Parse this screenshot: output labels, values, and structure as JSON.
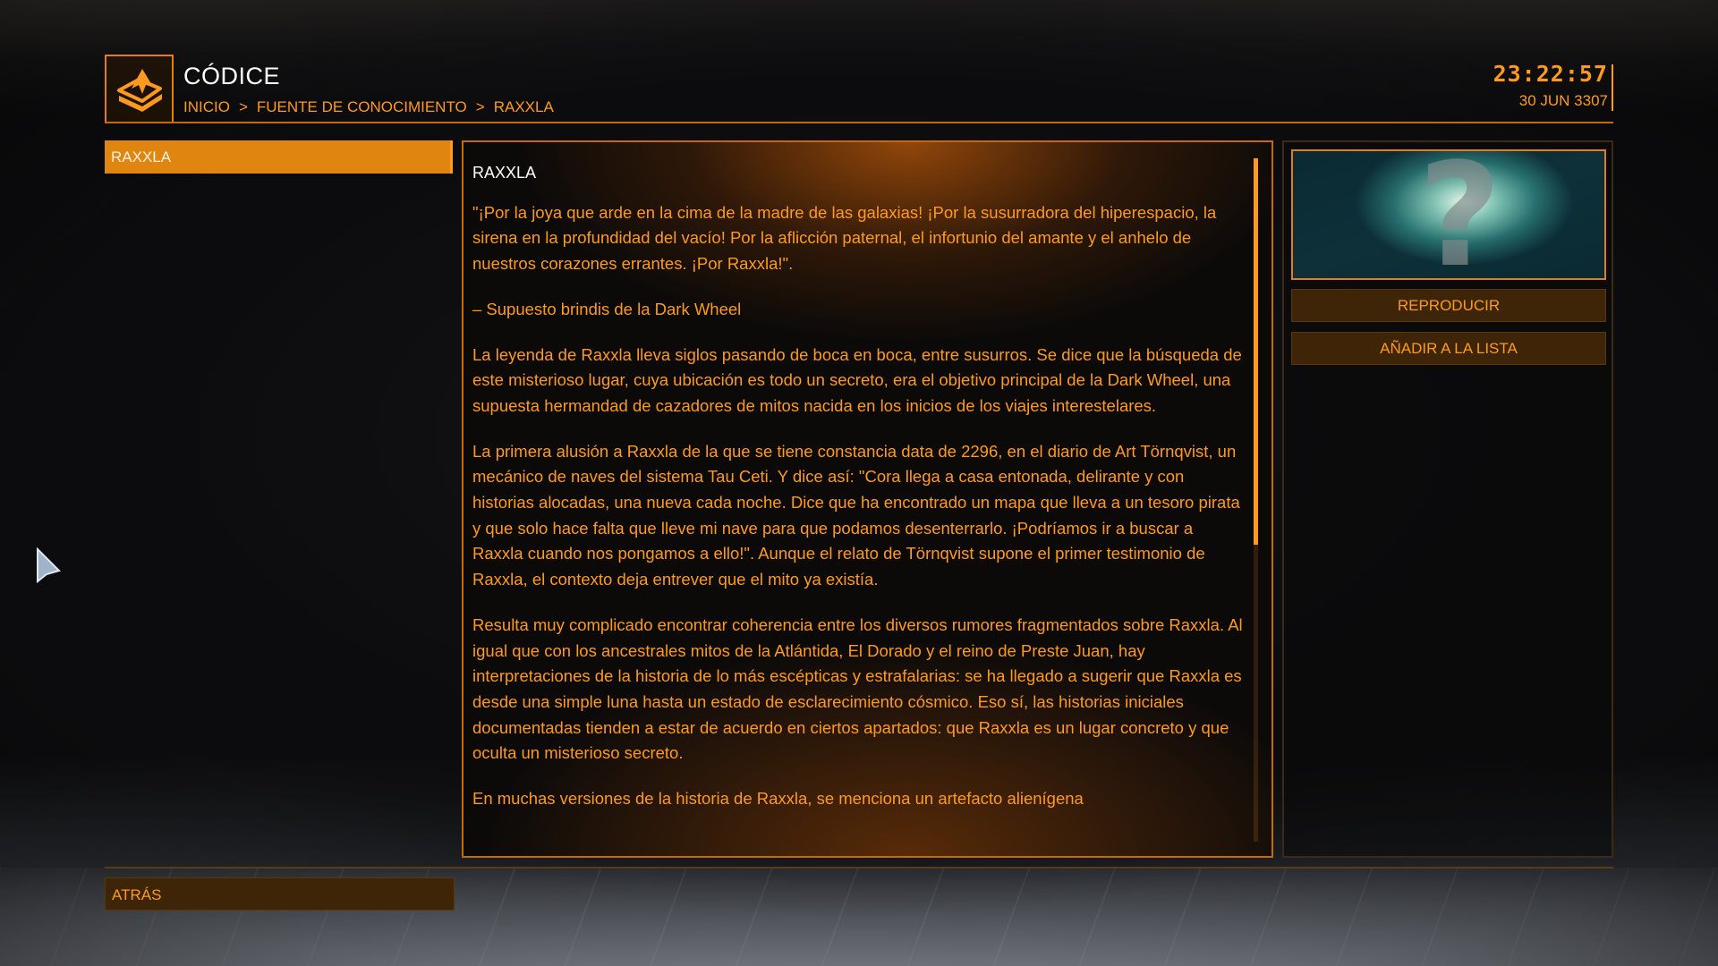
{
  "header": {
    "title": "CÓDICE",
    "logo_icon": "codex-book-icon",
    "breadcrumb": [
      "INICIO",
      ">",
      "FUENTE DE CONOCIMIENTO",
      ">",
      "RAXXLA"
    ],
    "time": "23:22:57",
    "date": "30 JUN 3307"
  },
  "sidebar": {
    "items": [
      {
        "label": "RAXXLA",
        "selected": true
      }
    ]
  },
  "article": {
    "title": "RAXXLA",
    "paragraphs": [
      "\"¡Por la joya que arde en la cima de la madre de las galaxias! ¡Por la susurradora del hiperespacio, la sirena en la profundidad del vacío! Por la aflicción paternal, el infortunio del amante y el anhelo de nuestros corazones errantes. ¡Por Raxxla!\".",
      "– Supuesto brindis de la Dark Wheel",
      "La leyenda de Raxxla lleva siglos pasando de boca en boca, entre susurros. Se dice que la búsqueda de este misterioso lugar, cuya ubicación es todo un secreto, era el objetivo principal de la Dark Wheel, una supuesta hermandad de cazadores de mitos nacida en los inicios de los viajes interestelares.",
      "La primera alusión a Raxxla de la que se tiene constancia data de 2296, en el diario de Art Törnqvist, un mecánico de naves del sistema Tau Ceti. Y dice así: \"Cora llega a casa entonada, delirante y con historias alocadas, una nueva cada noche. Dice que ha encontrado un mapa que lleva a un tesoro pirata y que solo hace falta que lleve mi nave para que podamos desenterrarlo. ¡Podríamos ir a buscar a Raxxla cuando nos pongamos a ello!\". Aunque el relato de Törnqvist supone el primer testimonio de Raxxla, el contexto deja entrever que el mito ya existía.",
      "Resulta muy complicado encontrar coherencia entre los diversos rumores fragmentados sobre Raxxla. Al igual que con los ancestrales mitos de la Atlántida, El Dorado y el reino de Preste Juan, hay interpretaciones de la historia de lo más escépticas y estrafalarias: se ha llegado a sugerir que Raxxla es desde una simple luna hasta un estado de esclarecimiento cósmico. Eso sí, las historias iniciales documentadas tienden a estar de acuerdo en ciertos apartados: que Raxxla es un lugar concreto y que oculta un misterioso secreto.",
      "En muchas versiones de la historia de Raxxla, se menciona un artefacto alienígena"
    ],
    "scroll_position_fraction": 0.0,
    "scroll_visible_fraction": 0.57
  },
  "side_panel": {
    "image_icon": "unknown-question-mark-image",
    "play_label": "REPRODUCIR",
    "add_label": "AÑADIR A LA LISTA"
  },
  "footer": {
    "back_label": "ATRÁS"
  },
  "colors": {
    "accent": "#ff9a1f",
    "accent_dark": "#e0850f",
    "button_bg": "#3e2507"
  }
}
